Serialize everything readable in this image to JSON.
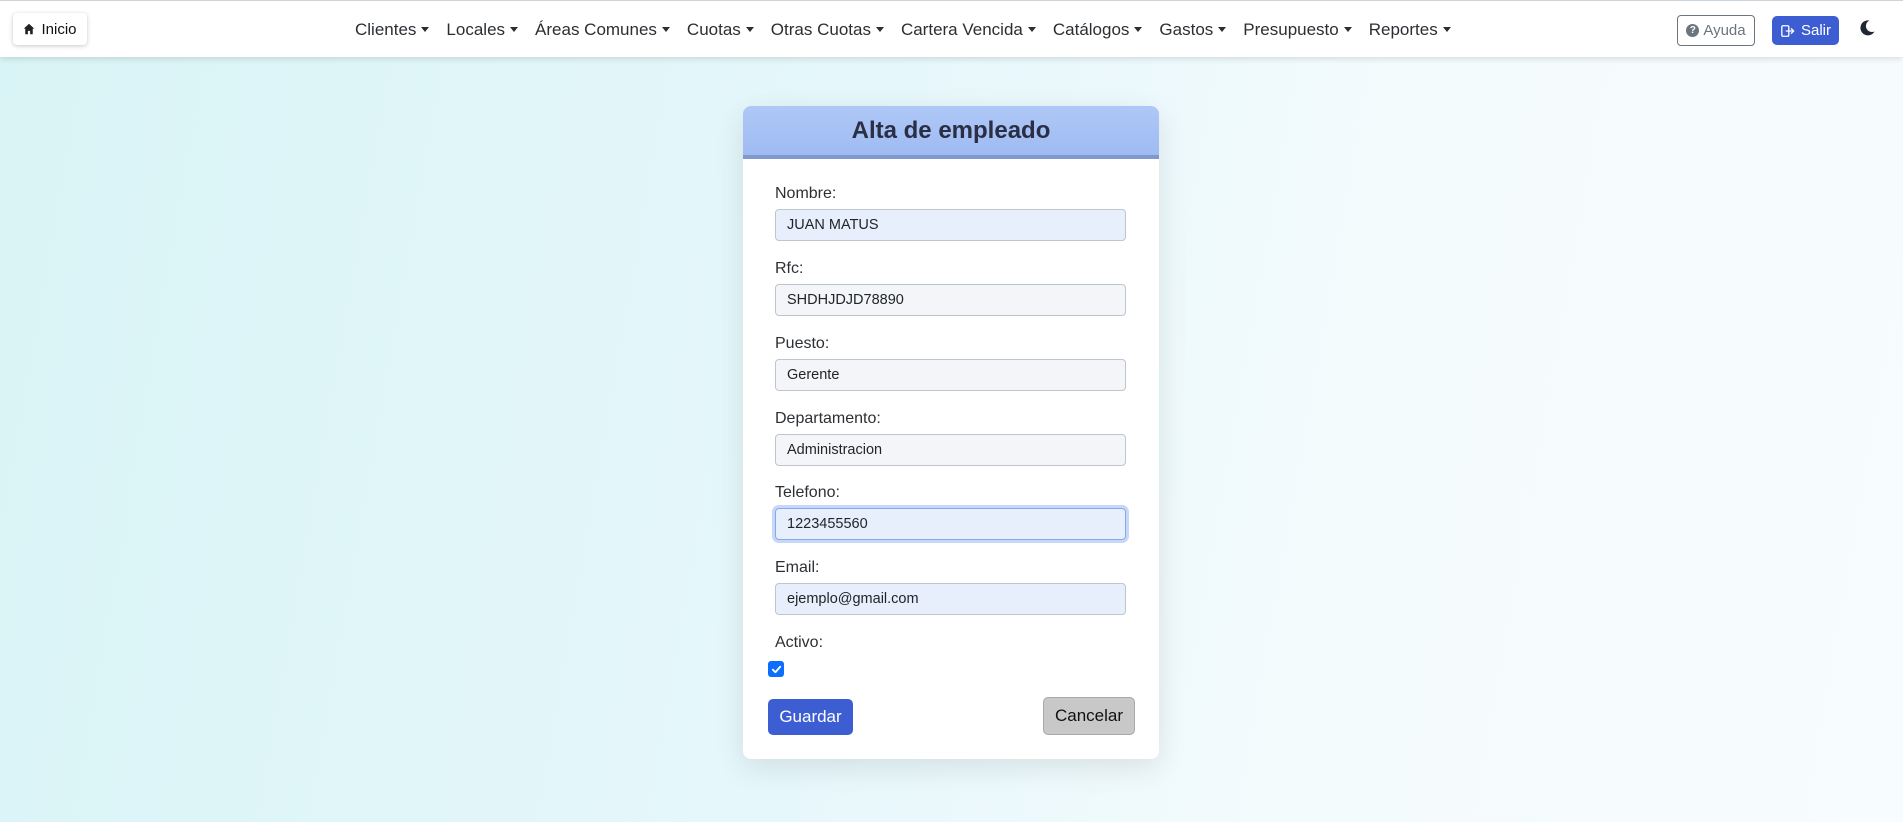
{
  "navbar": {
    "home_label": "Inicio",
    "menu": [
      {
        "label": "Clientes"
      },
      {
        "label": "Locales"
      },
      {
        "label": "Áreas Comunes"
      },
      {
        "label": "Cuotas"
      },
      {
        "label": "Otras Cuotas"
      },
      {
        "label": "Cartera Vencida"
      },
      {
        "label": "Catálogos"
      },
      {
        "label": "Gastos"
      },
      {
        "label": "Presupuesto"
      },
      {
        "label": "Reportes"
      }
    ],
    "help_label": "Ayuda",
    "exit_label": "Salir",
    "icons": {
      "home": "house-icon",
      "help": "question-circle-icon",
      "exit": "logout-icon",
      "theme": "moon-icon"
    }
  },
  "form": {
    "title": "Alta de empleado",
    "fields": {
      "nombre": {
        "label": "Nombre:",
        "value": "JUAN MATUS"
      },
      "rfc": {
        "label": "Rfc:",
        "value": "SHDHJDJD78890"
      },
      "puesto": {
        "label": "Puesto:",
        "value": "Gerente"
      },
      "departamento": {
        "label": "Departamento:",
        "value": "Administracion"
      },
      "telefono": {
        "label": "Telefono:",
        "value": "1223455560"
      },
      "email": {
        "label": "Email:",
        "value": "ejemplo@gmail.com"
      }
    },
    "activo": {
      "label": "Activo:",
      "checked": true
    },
    "save_label": "Guardar",
    "cancel_label": "Cancelar"
  },
  "colors": {
    "primary": "#3d5ed3",
    "header": "#aec8f6",
    "checkbox": "#0d6efd",
    "cancel": "#c8c8c8"
  }
}
